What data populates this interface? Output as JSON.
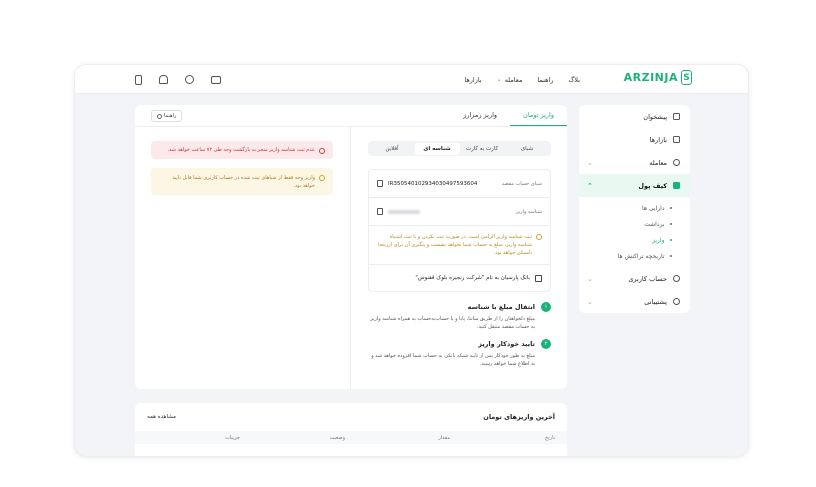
{
  "brand": {
    "logo_text": "ARZINJA",
    "logo_mark": "S"
  },
  "nav": {
    "items": [
      {
        "label": "بازارها",
        "dropdown": false
      },
      {
        "label": "معامله",
        "dropdown": true
      },
      {
        "label": "راهنما",
        "dropdown": false
      },
      {
        "label": "بلاگ",
        "dropdown": false
      }
    ]
  },
  "top_icons": [
    "wallet-icon",
    "user-icon",
    "bell-icon",
    "mobile-icon"
  ],
  "sidebar": {
    "items": [
      {
        "label": "پیشخوان",
        "icon": "dashboard-icon"
      },
      {
        "label": "بازارها",
        "icon": "chart-icon"
      },
      {
        "label": "معامله",
        "icon": "trade-icon",
        "chevron": "⌄"
      },
      {
        "label": "کیف پول",
        "icon": "wallet-icon",
        "chevron": "⌃",
        "active": true
      }
    ],
    "sub_items": [
      {
        "label": "دارایی ها"
      },
      {
        "label": "برداشت"
      },
      {
        "label": "واریز",
        "current": true
      },
      {
        "label": "تاریخچه تراکنش ها"
      }
    ],
    "bottom_items": [
      {
        "label": "حساب کاربری",
        "icon": "account-icon",
        "chevron": "⌄"
      },
      {
        "label": "پشتیبانی",
        "icon": "support-icon",
        "chevron": "⌄"
      }
    ]
  },
  "main": {
    "tabs": [
      {
        "label": "واریز تومان",
        "active": true
      },
      {
        "label": "واریز رمزارز",
        "active": false
      }
    ],
    "guide_label": "راهنما",
    "methods": [
      {
        "label": "شبای",
        "active": false
      },
      {
        "label": "کارت به کارت",
        "active": false
      },
      {
        "label": "شناسه ای",
        "active": true
      },
      {
        "label": "آفلاین",
        "active": false
      }
    ],
    "dest_sheba_label": "شبای حساب مقصد",
    "dest_sheba_value": "IR350540102934030497593604",
    "deposit_id_label": "شناسه واریز",
    "warning_inline": "ثبت شناسه واریز الزامی است. در صورت ثبت نکردن و یا ثبت اشتباه شناسه واریز، مبلغ به حساب شما نخواهد نشست و پیگیری آن برای ارزینجا ناممکن خواهد بود.",
    "bank_text": "بانک پارسیان به نام \"شرکت زنجیره بلوک ققنوس\"",
    "steps": [
      {
        "num": "۱",
        "title": "انتقال مبلغ با شناسه",
        "desc": "مبلغ دلخواهتان را از طریق ساتنا، پایا و یا حساب‌به‌حساب به همراه شناسه واریز به حساب مقصد منتقل کنید."
      },
      {
        "num": "۲",
        "title": "تایید خودکار واریز",
        "desc": "مبلغ به طور خودکار پس از تایید شبکه بانکی به حساب شما افزوده خواهد شد و به اطلاع شما خواهد رسید."
      }
    ],
    "alert_red": "عدم ثبت شناسه واریز منجر به بازگشت وجه طی ۷۲ ساعت خواهد شد.",
    "alert_yellow": "واریز وجه فقط از شباهای ثبت شده در حساب کاربری شما قابل تایید خواهد بود."
  },
  "history": {
    "title": "آخرین واریزهای تومان",
    "view_all": "مشاهده همه",
    "columns": [
      "تاریخ",
      "مقدار",
      "وضعیت",
      "جزییات"
    ]
  },
  "colors": {
    "accent": "#19b37a",
    "danger": "#c62f3b",
    "warning": "#a4791a"
  }
}
